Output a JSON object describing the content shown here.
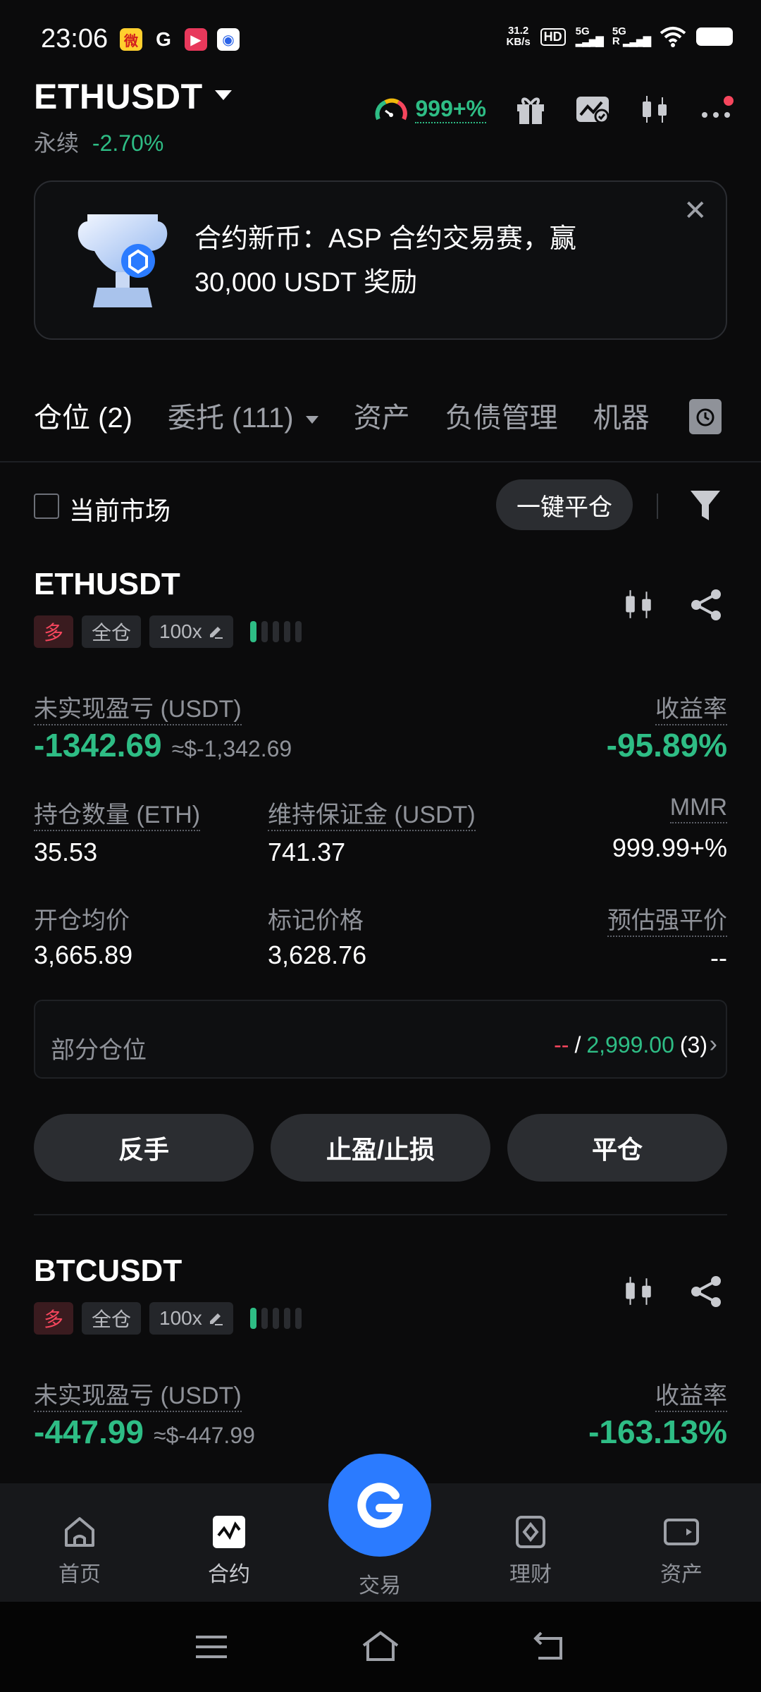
{
  "status_bar": {
    "time": "23:06",
    "app_icons": [
      "weibo-icon",
      "google-icon",
      "video-app-icon",
      "baidu-icon"
    ],
    "net_speed_value": "31.2",
    "net_speed_unit": "KB/s",
    "hd_label": "HD",
    "signal_1": "5G",
    "signal_2": "5G",
    "roaming": "R"
  },
  "header": {
    "pair": "ETHUSDT",
    "type_label": "永续",
    "change": "-2.70%",
    "risk_value": "999+%"
  },
  "banner": {
    "text": "合约新币：ASP 合约交易赛，赢 30,000 USDT 奖励",
    "close": "✕"
  },
  "tabs": [
    {
      "label": "仓位 (2)"
    },
    {
      "label": "委托 (111)"
    },
    {
      "label": "资产"
    },
    {
      "label": "负债管理"
    },
    {
      "label": "机器"
    }
  ],
  "filter": {
    "current_market_label": "当前市场",
    "close_all_label": "一键平仓"
  },
  "positions": [
    {
      "symbol": "ETHUSDT",
      "side": "多",
      "margin_mode": "全仓",
      "leverage": "100x",
      "unrealized_pnl_label": "未实现盈亏 (USDT)",
      "unrealized_pnl": "-1342.69",
      "unrealized_pnl_usd": "≈$-1,342.69",
      "roe_label": "收益率",
      "roe": "-95.89%",
      "size_label": "持仓数量 (ETH)",
      "size": "35.53",
      "maint_margin_label": "维持保证金 (USDT)",
      "maint_margin": "741.37",
      "mmr_label": "MMR",
      "mmr": "999.99+%",
      "entry_label": "开仓均价",
      "entry_price": "3,665.89",
      "mark_label": "标记价格",
      "mark_price": "3,628.76",
      "liq_label": "预估强平价",
      "liq_price": "--",
      "partial_label": "部分仓位",
      "partial_left": "--",
      "partial_sep": "/",
      "partial_right": "2,999.00",
      "partial_count": "(3)",
      "btn_reverse": "反手",
      "btn_tpsl": "止盈/止损",
      "btn_close": "平仓"
    },
    {
      "symbol": "BTCUSDT",
      "side": "多",
      "margin_mode": "全仓",
      "leverage": "100x",
      "unrealized_pnl_label": "未实现盈亏 (USDT)",
      "unrealized_pnl": "-447.99",
      "unrealized_pnl_usd": "≈$-447.99",
      "roe_label": "收益率",
      "roe": "-163.13%"
    }
  ],
  "bottom_nav": [
    {
      "label": "首页",
      "icon": "home-icon"
    },
    {
      "label": "合约",
      "icon": "futures-icon"
    },
    {
      "label": "交易",
      "icon": "trade-icon"
    },
    {
      "label": "理财",
      "icon": "earn-icon"
    },
    {
      "label": "资产",
      "icon": "wallet-icon"
    }
  ],
  "colors": {
    "background": "#0b0b0c",
    "up": "#2ebd85",
    "down": "#f6465d",
    "accent": "#2b7bff"
  }
}
